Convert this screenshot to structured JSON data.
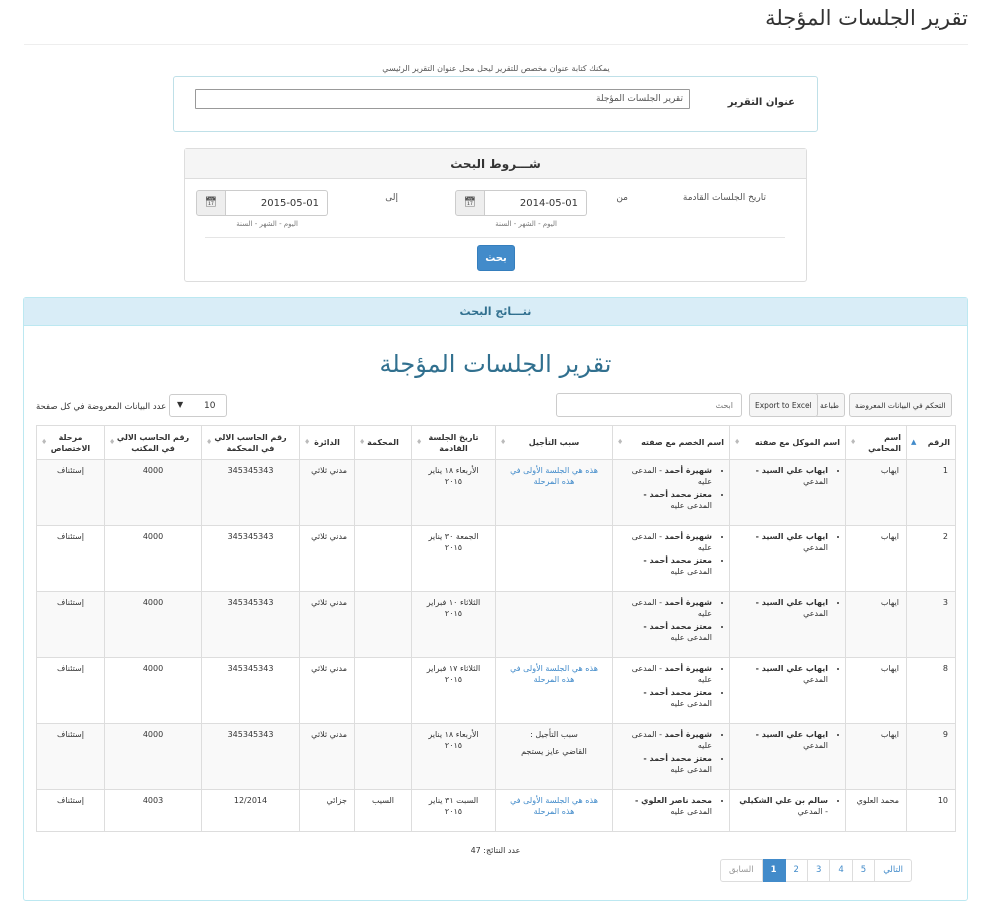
{
  "page": {
    "title": "تقرير الجلسات المؤجلة"
  },
  "report": {
    "hint": "يمكنك كتابة عنوان مخصص للتقرير ليحل محل عنوان التقرير الرئيسي",
    "label": "عنوان التقرير",
    "value": "تقرير الجلسات المؤجلة"
  },
  "search": {
    "header": "شـــروط البحث",
    "field_label": "تاريخ الجلسات القادمة",
    "from_label": "من",
    "to_label": "إلى",
    "from_value": "2014-05-01",
    "to_value": "2015-05-01",
    "date_format_hint": "اليوم - الشهر - السنة",
    "button": "بحث"
  },
  "results": {
    "header": "نتـــائج البحث",
    "report_title": "تقرير الجلسات المؤجلة",
    "toolbar": {
      "columns_btn": "التحكم في البيانات المعروضة",
      "print_btn": "طباعة",
      "excel_btn": "Export to Excel",
      "filter_placeholder": "ابحث"
    },
    "page_length": {
      "value": "10",
      "label": "عدد البيانات المعروضة في كل صفحة"
    },
    "columns": [
      "الرقم",
      "اسم المحامي",
      "اسم الموكل مع صفته",
      "اسم الخصم مع صفته",
      "سبب التأجيل",
      "تاريخ الجلسة القادمة",
      "المحكمة",
      "الدائرة",
      "رقم الحاسب الالي في المحكمة",
      "رقم الحاسب الالي في المكتب",
      "مرحلة الاختصاص"
    ],
    "rows": [
      {
        "id": "1",
        "lawyer": "ايهاب",
        "client_name": "ايهاب علي السيد -",
        "client_role": "المدعي",
        "opp1_name": "شهيرة أحمد",
        "opp1_role": " - المدعى عليه",
        "opp2_name": "معتز محمد أحمد -",
        "opp2_role": "المدعى عليه",
        "reason": "هذه هي الجلسة الأولى في هذه المرحلة",
        "date": "الأربعاء ١٨ يناير ٢٠١٥",
        "court": "",
        "circuit": "مدني ثلاثي",
        "court_no": "345345343",
        "office_no": "4000",
        "stage": "إستئناف"
      },
      {
        "id": "2",
        "lawyer": "ايهاب",
        "client_name": "ايهاب علي السيد -",
        "client_role": "المدعي",
        "opp1_name": "شهيرة أحمد",
        "opp1_role": " - المدعى عليه",
        "opp2_name": "معتز محمد أحمد -",
        "opp2_role": "المدعى عليه",
        "reason": "",
        "date": "الجمعة ٣٠ يناير ٢٠١٥",
        "court": "",
        "circuit": "مدني ثلاثي",
        "court_no": "345345343",
        "office_no": "4000",
        "stage": "إستئناف"
      },
      {
        "id": "3",
        "lawyer": "ايهاب",
        "client_name": "ايهاب علي السيد -",
        "client_role": "المدعي",
        "opp1_name": "شهيرة أحمد",
        "opp1_role": " - المدعى عليه",
        "opp2_name": "معتز محمد أحمد -",
        "opp2_role": "المدعى عليه",
        "reason": "",
        "date": "الثلاثاء ١٠ فبراير ٢٠١٥",
        "court": "",
        "circuit": "مدني ثلاثي",
        "court_no": "345345343",
        "office_no": "4000",
        "stage": "إستئناف"
      },
      {
        "id": "8",
        "lawyer": "ايهاب",
        "client_name": "ايهاب علي السيد -",
        "client_role": "المدعي",
        "opp1_name": "شهيرة أحمد",
        "opp1_role": " - المدعى عليه",
        "opp2_name": "معتز محمد أحمد -",
        "opp2_role": "المدعى عليه",
        "reason": "هذه هي الجلسة الأولى في هذه المرحلة",
        "date": "الثلاثاء ١٧ فبراير ٢٠١٥",
        "court": "",
        "circuit": "مدني ثلاثي",
        "court_no": "345345343",
        "office_no": "4000",
        "stage": "إستئناف"
      },
      {
        "id": "9",
        "lawyer": "ايهاب",
        "client_name": "ايهاب علي السيد -",
        "client_role": "المدعي",
        "opp1_name": "شهيرة أحمد",
        "opp1_role": " - المدعى عليه",
        "opp2_name": "معتز محمد أحمد -",
        "opp2_role": "المدعى عليه",
        "reason_title": "سبب التأجيل :",
        "reason_detail": "القاضي عايز يستجم",
        "date": "الأربعاء ١٨ يناير ٢٠١٥",
        "court": "",
        "circuit": "مدني ثلاثي",
        "court_no": "345345343",
        "office_no": "4000",
        "stage": "إستئناف"
      },
      {
        "id": "10",
        "lawyer": "محمد العلوي",
        "client_name": "سالم بن علي الشكيلي",
        "client_role": "- المدعي",
        "opp1_name": "محمد ناصر العلوي -",
        "opp1_role": "المدعى عليه",
        "reason": "هذه هي الجلسة الأولى في هذه المرحلة",
        "date": "السبت ٣١ يناير ٢٠١٥",
        "court": "السيب",
        "circuit": "جزائي",
        "court_no": "12/2014",
        "office_no": "4003",
        "stage": "إستئناف"
      }
    ],
    "count_text": "عدد النتائج: 47",
    "pagination": {
      "next": "التالي",
      "pages": [
        "5",
        "4",
        "3",
        "2",
        "1"
      ],
      "prev": "السابق"
    }
  }
}
